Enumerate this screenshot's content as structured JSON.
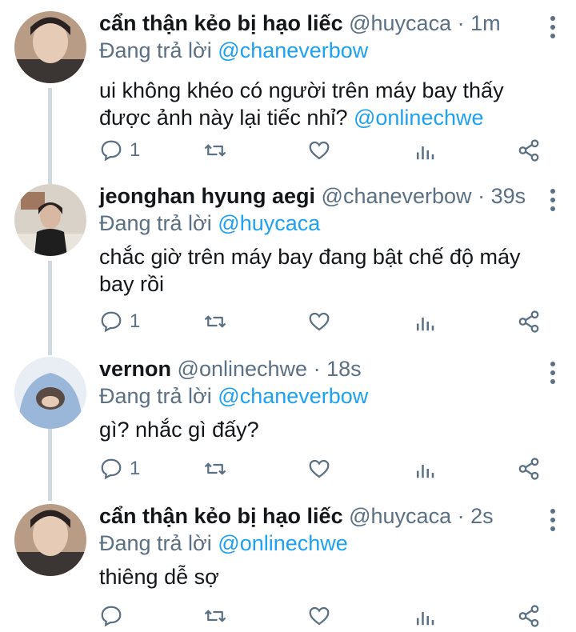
{
  "tweets": [
    {
      "name": "cẩn thận kẻo bị hạo liếc",
      "handle": "@huycaca",
      "dot": "·",
      "time": "1m",
      "reply_prefix": "Đang trả lời",
      "reply_to": "@chaneverbow",
      "text_main": "ui không khéo có người trên máy bay thấy được ảnh này lại tiếc nhỉ?",
      "text_mention": "@onlinechwe",
      "reply_count": "1"
    },
    {
      "name": "jeonghan hyung aegi",
      "handle": "@chaneverbow",
      "dot": "·",
      "time": "39s",
      "reply_prefix": "Đang trả lời",
      "reply_to": "@huycaca",
      "text_main": "chắc giờ trên máy bay đang bật chế độ máy bay rồi",
      "text_mention": "",
      "reply_count": "1"
    },
    {
      "name": "vernon",
      "handle": "@onlinechwe",
      "dot": "·",
      "time": "18s",
      "reply_prefix": "Đang trả lời",
      "reply_to": "@chaneverbow",
      "text_main": "gì? nhắc gì đấy?",
      "text_mention": "",
      "reply_count": "1"
    },
    {
      "name": "cẩn thận kẻo bị hạo liếc",
      "handle": "@huycaca",
      "dot": "·",
      "time": "2s",
      "reply_prefix": "Đang trả lời",
      "reply_to": "@onlinechwe",
      "text_main": "thiêng dễ sợ",
      "text_mention": "",
      "reply_count": ""
    }
  ],
  "icons": {
    "reply": "reply-icon",
    "retweet": "retweet-icon",
    "like": "heart-icon",
    "analytics": "analytics-icon",
    "share": "share-icon",
    "more": "more-icon"
  },
  "colors": {
    "accent": "#1da1f2",
    "secondary_text": "#5b7083",
    "thread_line": "#cfd9de"
  }
}
